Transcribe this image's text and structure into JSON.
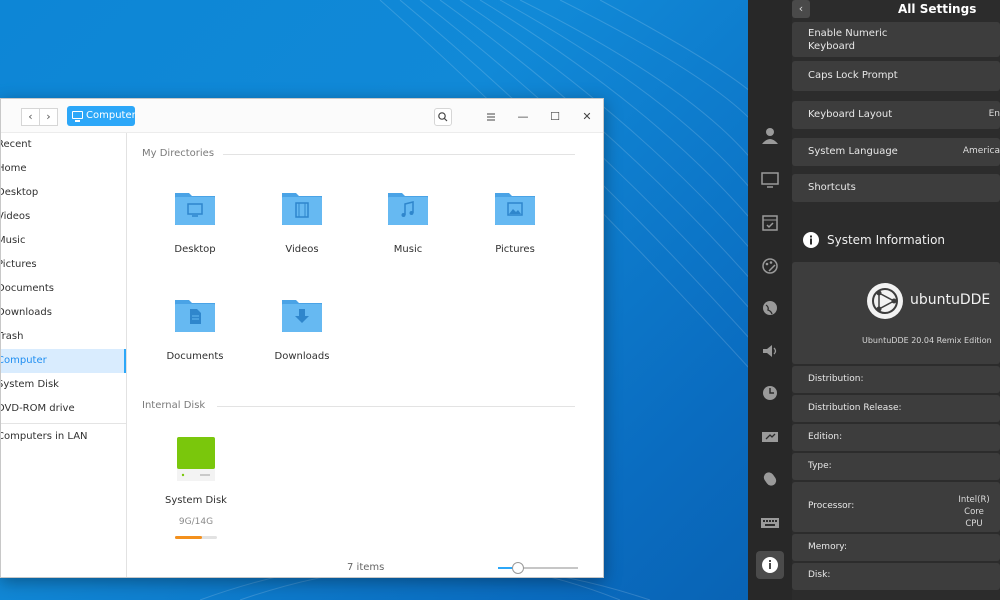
{
  "file_manager": {
    "breadcrumb": "Computer",
    "nav": {
      "back": "‹",
      "forward": "›"
    },
    "toolbar": {
      "search_icon": "search-icon",
      "menu_icon": "menu-icon",
      "minimize": "—",
      "maximize": "☐",
      "close": "✕"
    },
    "sidebar": {
      "items": [
        {
          "label": "Recent"
        },
        {
          "label": "Home"
        },
        {
          "label": "Desktop"
        },
        {
          "label": "Videos"
        },
        {
          "label": "Music"
        },
        {
          "label": "Pictures"
        },
        {
          "label": "Documents"
        },
        {
          "label": "Downloads"
        },
        {
          "label": "Trash"
        },
        {
          "label": "Computer"
        },
        {
          "label": "System Disk"
        },
        {
          "label": "DVD-ROM drive"
        },
        {
          "label": "Computers in LAN"
        }
      ],
      "active": "Computer"
    },
    "sections": {
      "my_directories": "My Directories",
      "internal_disk": "Internal Disk"
    },
    "folders": [
      {
        "label": "Desktop",
        "icon": "desktop-icon"
      },
      {
        "label": "Videos",
        "icon": "video-icon"
      },
      {
        "label": "Music",
        "icon": "music-icon"
      },
      {
        "label": "Pictures",
        "icon": "picture-icon"
      },
      {
        "label": "Documents",
        "icon": "document-icon"
      },
      {
        "label": "Downloads",
        "icon": "download-icon"
      }
    ],
    "disk": {
      "label": "System Disk",
      "usage": "9G/14G",
      "used_fraction": 0.64,
      "color": "#7ac70c"
    },
    "status": {
      "count": "7 items",
      "zoom_fraction": 0.25
    }
  },
  "settings": {
    "title": "All Settings",
    "back": "‹",
    "rows": {
      "numeric_keyboard": "Enable Numeric Keyboard",
      "caps_lock": "Caps Lock Prompt",
      "keyboard_layout": "Keyboard Layout",
      "keyboard_layout_value": "En",
      "system_language": "System Language",
      "system_language_value": "America",
      "shortcuts": "Shortcuts"
    },
    "system_info": {
      "heading": "System Information",
      "logo_text": "ubuntuDDE",
      "edition_caption": "UbuntuDDE 20.04 Remix Edition",
      "fields": [
        {
          "label": "Distribution:",
          "value": ""
        },
        {
          "label": "Distribution Release:",
          "value": ""
        },
        {
          "label": "Edition:",
          "value": ""
        },
        {
          "label": "Type:",
          "value": ""
        },
        {
          "label": "Processor:",
          "value": "Intel(R) Core\nCPU"
        },
        {
          "label": "Memory:",
          "value": ""
        },
        {
          "label": "Disk:",
          "value": ""
        }
      ]
    }
  },
  "colors": {
    "accent": "#2ca7f8",
    "folder": "#5fb3ef",
    "panel_bg": "#2c2c2c",
    "row_bg": "#3d3d3d"
  }
}
